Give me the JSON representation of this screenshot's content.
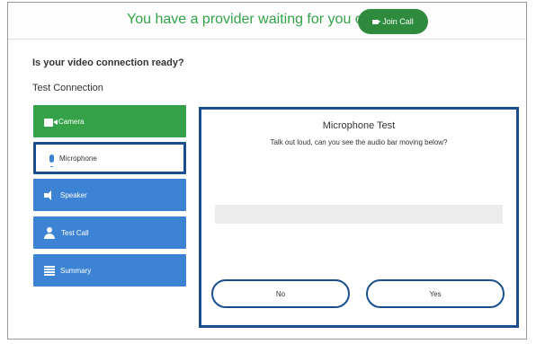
{
  "banner": {
    "message": "You have a provider waiting for you on a call",
    "join_label": "Join Call"
  },
  "question": "Is your video connection ready?",
  "subheading": "Test Connection",
  "sidebar": {
    "items": [
      {
        "label": "Camera",
        "icon": "camera-icon",
        "state": "complete"
      },
      {
        "label": "Microphone",
        "icon": "microphone-icon",
        "state": "active"
      },
      {
        "label": "Speaker",
        "icon": "speaker-icon",
        "state": "pending"
      },
      {
        "label": "Test Call",
        "icon": "user-icon",
        "state": "pending"
      },
      {
        "label": "Summary",
        "icon": "list-icon",
        "state": "pending"
      }
    ]
  },
  "panel": {
    "title": "Microphone Test",
    "instruction": "Talk out loud, can you see the audio bar moving below?",
    "audio_level": 0,
    "no_label": "No",
    "yes_label": "Yes"
  },
  "colors": {
    "green": "#35a24a",
    "blue": "#3d83d4",
    "navy": "#1a4f8f"
  }
}
